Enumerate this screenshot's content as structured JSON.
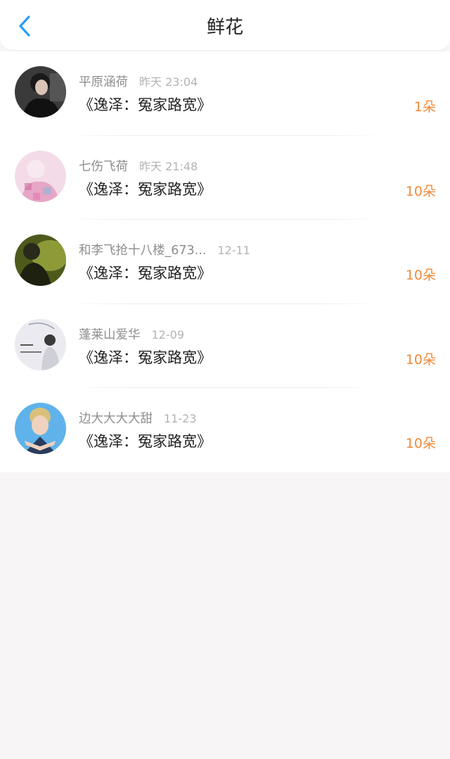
{
  "header": {
    "title": "鲜花",
    "back_icon": "chevron-left-icon",
    "accent": "#2a9df4"
  },
  "colors": {
    "amount": "#f08a3a",
    "name": "#8e8e8e",
    "time": "#b3b3b3"
  },
  "items": [
    {
      "name": "平原涵荷",
      "time": "昨天 23:04",
      "book": "《逸泽：冤家路宽》",
      "amount": "1朵"
    },
    {
      "name": "七伤飞荷",
      "time": "昨天 21:48",
      "book": "《逸泽：冤家路宽》",
      "amount": "10朵"
    },
    {
      "name": "和李飞抢十八楼_673...",
      "time": "12-11",
      "book": "《逸泽：冤家路宽》",
      "amount": "10朵"
    },
    {
      "name": "蓬莱山爱华",
      "time": "12-09",
      "book": "《逸泽：冤家路宽》",
      "amount": "10朵"
    },
    {
      "name": "边大大大大甜",
      "time": "11-23",
      "book": "《逸泽：冤家路宽》",
      "amount": "10朵"
    }
  ]
}
